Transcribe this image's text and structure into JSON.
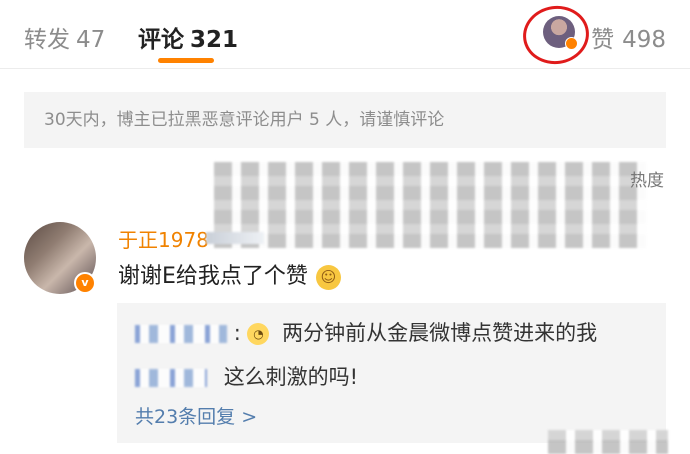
{
  "tabs": [
    {
      "label": "转发",
      "count": "47"
    },
    {
      "label": "评论",
      "count": "321"
    }
  ],
  "likes": {
    "icon_label": "赞",
    "count": "498"
  },
  "notice": "30天内，博主已拉黑恶意评论用户 5 人，请谨慎评论",
  "sort_label": "热度",
  "comment": {
    "username": "于正1978",
    "text": "谢谢E给我点了个赞",
    "emoji": "smile-think"
  },
  "reply": {
    "colon": ":",
    "text_line1": "两分钟前从金晨微博点赞进来的我",
    "text_line2": "这么刺激的吗!",
    "more_label": "共23条回复 >"
  },
  "colors": {
    "accent": "#ff8200",
    "link": "#537dad",
    "highlight_circle": "#e01b1b"
  }
}
